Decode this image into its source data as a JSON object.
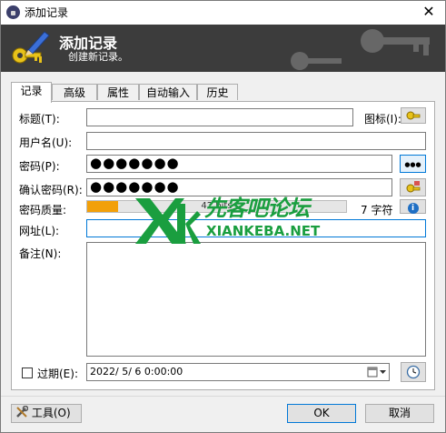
{
  "window": {
    "title": "添加记录",
    "close_glyph": "✕"
  },
  "banner": {
    "title": "添加记录",
    "subtitle": "创建新记录。"
  },
  "tabs": [
    {
      "label": "记录"
    },
    {
      "label": "高级"
    },
    {
      "label": "属性"
    },
    {
      "label": "自动输入"
    },
    {
      "label": "历史"
    }
  ],
  "form": {
    "title_label": "标题(T):",
    "title_value": "",
    "icon_label": "图标(I):",
    "username_label": "用户名(U):",
    "username_value": "",
    "password_label": "密码(P):",
    "password_value": "●●●●●●●",
    "confirm_label": "确认密码(R):",
    "confirm_value": "●●●●●●●",
    "quality_label": "密码质量:",
    "quality_bits": "42 bits",
    "quality_fraction": 0.12,
    "char_count": "7 字符",
    "url_label": "网址(L):",
    "url_value": "",
    "notes_label": "备注(N):",
    "notes_value": "",
    "dots_glyph": "●●●",
    "info_glyph": "i",
    "expires_label": "过期(E):",
    "expires_value": "2022/ 5/ 6  0:00:00",
    "expires_checked": false
  },
  "footer": {
    "tools_label": "工具(O)",
    "ok_label": "OK",
    "cancel_label": "取消"
  },
  "watermark": {
    "text_cn": "先客吧论坛",
    "text_en": "XIANKEBA.NET"
  },
  "colors": {
    "banner_bg": "#3c3c3c",
    "quality_fill": "#f2a00a",
    "focus_border": "#0078d7",
    "watermark": "#1a9e3f"
  },
  "icons": [
    "lock-icon",
    "key-pen-icon",
    "key-icon",
    "dots-icon",
    "generator-icon",
    "info-icon",
    "calendar-icon",
    "clock-icon",
    "tools-icon",
    "close-icon"
  ]
}
